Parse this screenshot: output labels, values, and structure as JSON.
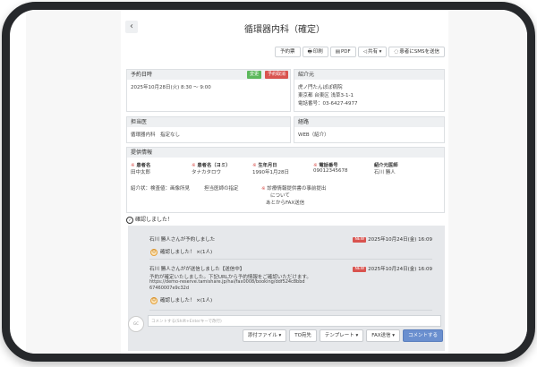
{
  "header": {
    "back_label": "‹",
    "title": "循環器内科（確定）"
  },
  "toolbar": [
    {
      "label": "予約票",
      "icon": "",
      "icon_name": ""
    },
    {
      "label": "印刷",
      "icon": "🖶",
      "icon_name": "print-icon"
    },
    {
      "label": "PDF",
      "icon": "▤",
      "icon_name": "pdf-icon"
    },
    {
      "label": "共有 ▾",
      "icon": "◁",
      "icon_name": "share-icon"
    },
    {
      "label": "患者にSMSを送信",
      "icon": "◌",
      "icon_name": "sms-icon"
    }
  ],
  "reservation": {
    "heading": "予約日時",
    "status_badge": "変更",
    "cancel_badge": "予約取消",
    "datetime": "2025年10月28日(火) 8:30 ～ 9:00"
  },
  "referrer": {
    "heading": "紹介元",
    "name": "虎ノ門たんぽぽ病院",
    "address": "東京都 台東区 浅草3-1-1",
    "phone": "電話番号：03-6427-4977"
  },
  "department": {
    "heading": "担当医",
    "value": "循環器内科　指定なし"
  },
  "route": {
    "heading": "経路",
    "value": "WEB（紹介）"
  },
  "provided_info": {
    "heading": "提供情報",
    "fields": [
      {
        "required": "※",
        "label": "患者名",
        "value": "田中太郎"
      },
      {
        "required": "※",
        "label": "患者名（ヨミ）",
        "value": "タナカタロウ"
      },
      {
        "required": "※",
        "label": "生年月日",
        "value": "1990年1月28日"
      },
      {
        "required": "※",
        "label": "電話番号",
        "value": "09012345678"
      },
      {
        "required": "",
        "label": "紹介元医師",
        "value": "石川 勝人"
      }
    ],
    "note1": "紹介状：検査値：画像所見",
    "note2": "担当医師の指定",
    "note3_req": "※",
    "note3_line1": "診療情報提供書の事前提出",
    "note3_line2": "について",
    "note3_line3": "あとからFAX送信"
  },
  "confirm_heading": "確認しました！",
  "comments": [
    {
      "author": "石川 勝人さんが予約しました",
      "new_label": "NEW",
      "date": "2025年10月24日(金) 16:09",
      "ack": "確認しました！ ×(1人)"
    },
    {
      "author": "石川 勝人さんがが送信しました【送信中】",
      "new_label": "NEW",
      "date": "2025年10月24日(金) 16:09",
      "body_line1": "予約が確定いたしました。下記URLから予約情報をご確認いただけます。",
      "body_line2": "https://demo-reserve.tamishare.jp/hai/fax0008/booking/ddf524c8bbd",
      "body_line3": "67460007e9c32d",
      "ack": "確認しました！ ×(1人)"
    }
  ],
  "composer": {
    "avatar_label": "GC",
    "placeholder": "コメントする(Shift+Enterキーで改行)",
    "buttons": {
      "attach": "添付ファイル ▾",
      "to": "TO宛先",
      "template": "テンプレート ▾",
      "fax": "FAX送信 ▾",
      "submit": "コメントする"
    }
  },
  "colors": {
    "frame": "#26282b",
    "accent_blue": "#6a8fcf",
    "badge_green": "#5cb85c",
    "badge_red": "#d9534f"
  }
}
